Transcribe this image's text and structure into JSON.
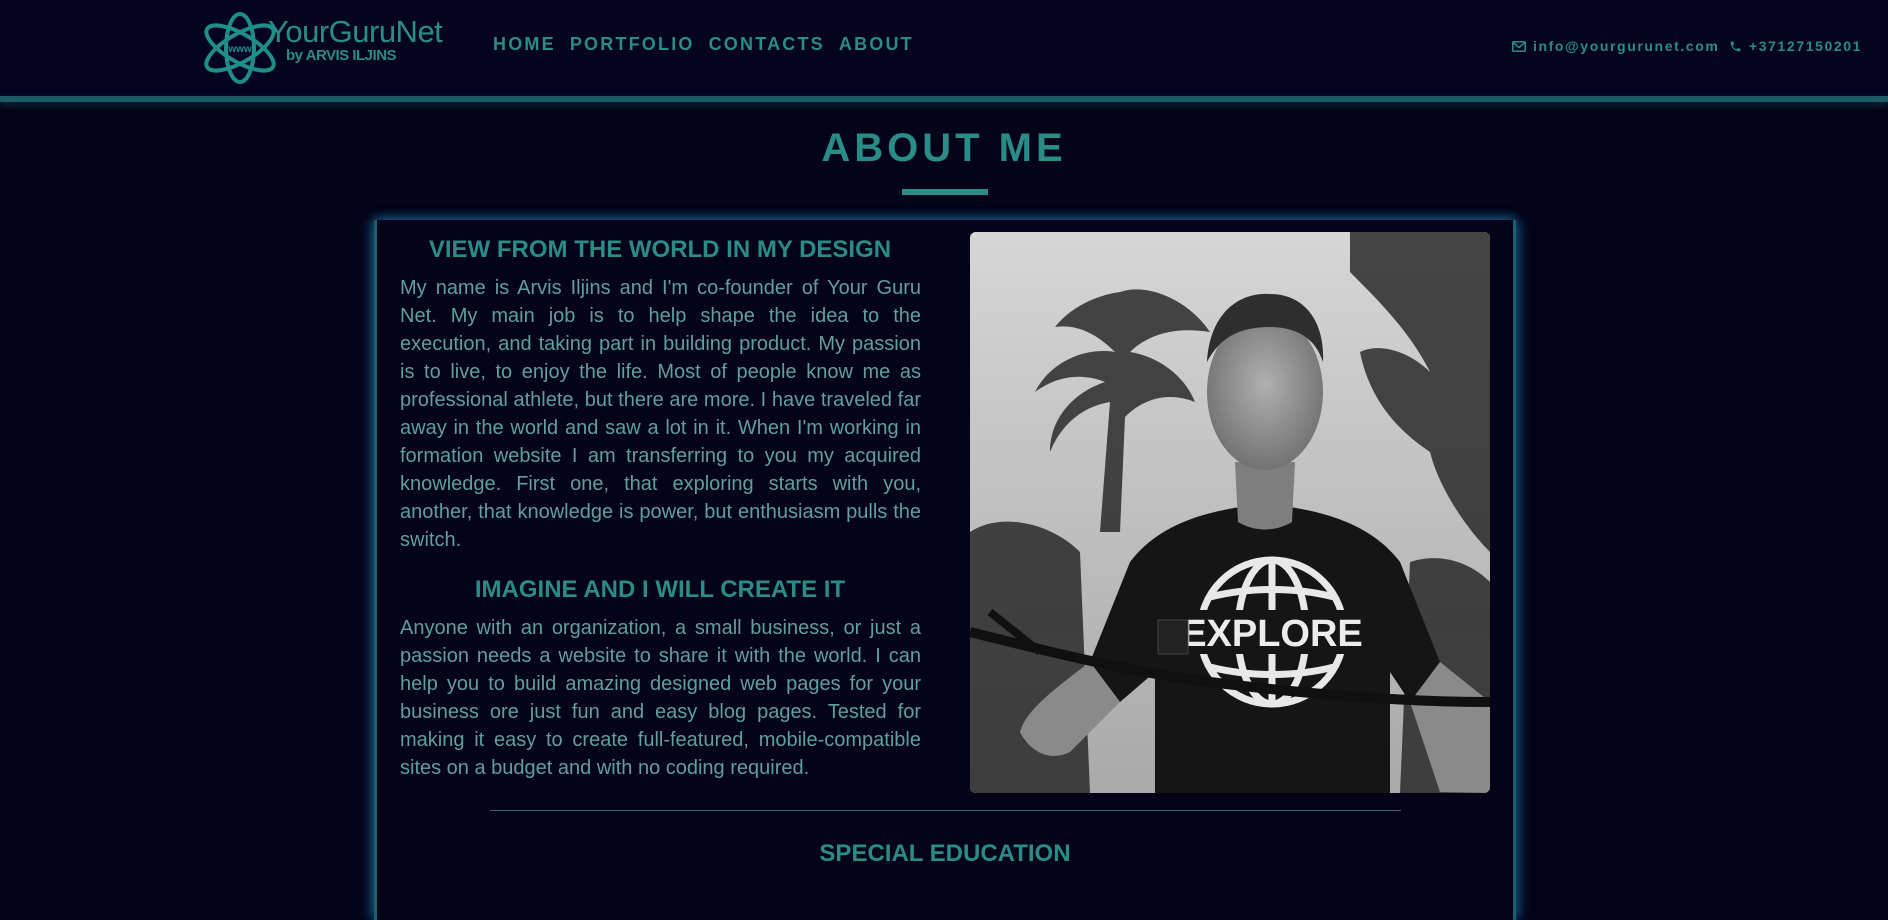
{
  "brand": {
    "name": "YourGuruNet",
    "subtitle": "by ARVIS ILJINS",
    "logo_badge": "www"
  },
  "nav": {
    "items": [
      {
        "label": "HOME"
      },
      {
        "label": "PORTFOLIO"
      },
      {
        "label": "CONTACTS"
      },
      {
        "label": "ABOUT"
      }
    ]
  },
  "contacts": {
    "email": "info@yourgurunet.com",
    "phone": "+37127150201",
    "email_icon": "envelope-icon",
    "phone_icon": "phone-icon"
  },
  "page": {
    "title": "ABOUT ME"
  },
  "sections": {
    "view": {
      "heading": "VIEW FROM THE WORLD IN MY DESIGN",
      "text": "My name is Arvis Iljins and I'm co-founder of Your Guru Net. My main job is to help shape the idea to the execution, and taking part in building product. My passion is to live, to enjoy the life. Most of people know me as professional athlete, but there are more. I have traveled far away in the world and saw a lot in it. When I'm working in formation website I am transferring to you my acquired knowledge. First one, that exploring starts with you, another, that knowledge is power, but enthusiasm pulls the switch."
    },
    "imagine": {
      "heading": "IMAGINE AND I WILL CREATE IT",
      "text": "Anyone with an organization, a small business, or just a passion needs a website to share it with the world. I can help you to build amazing designed web pages for your business ore just fun and easy blog pages. Tested for making it easy to create full-featured, mobile-compatible sites on a budget and with no coding required."
    },
    "special": {
      "heading": "SPECIAL EDUCATION"
    }
  },
  "photo": {
    "shirt_text": "EXPLORE"
  },
  "colors": {
    "background": "#04031a",
    "accent": "#2a8c87",
    "body_text": "#5f9fa0",
    "card_glow": "#1c5f6e"
  }
}
